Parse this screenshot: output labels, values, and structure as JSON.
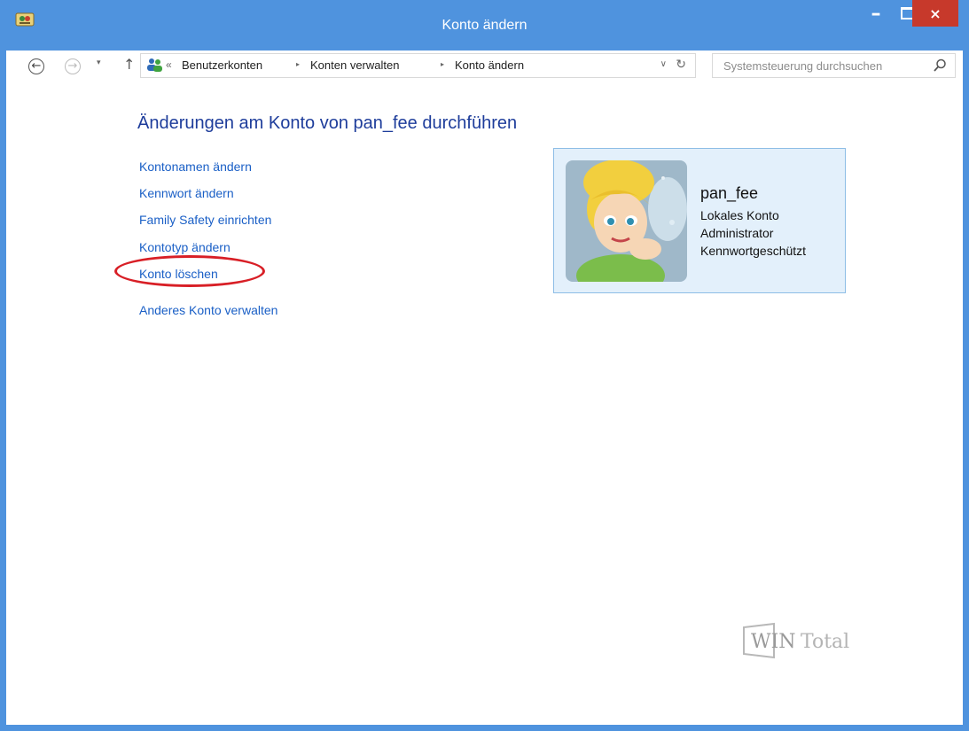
{
  "window": {
    "title": "Konto ändern",
    "icons": {
      "title": "control-panel-icon",
      "minimize": "minimize-icon",
      "maximize": "maximize-icon",
      "close": "close-icon"
    },
    "controls": {
      "minimize": "–",
      "close": "×"
    }
  },
  "navigation": {
    "back": "←",
    "forward": "→",
    "recent": "▾",
    "up": "↑",
    "chevrons": "«",
    "breadcrumbs": [
      "Benutzerkonten",
      "Konten verwalten",
      "Konto ändern"
    ],
    "separator": "▸",
    "dropdown": "∨",
    "refresh": "↻",
    "search_placeholder": "Systemsteuerung durchsuchen"
  },
  "main": {
    "heading": "Änderungen am Konto von pan_fee durchführen",
    "tasks": [
      "Kontonamen ändern",
      "Kennwort ändern",
      "Family Safety einrichten",
      "Kontotyp ändern",
      "Konto löschen"
    ],
    "other_link": "Anderes Konto verwalten",
    "highlighted_task": "Konto löschen",
    "highlight_color": "#d81f26"
  },
  "account": {
    "name": "pan_fee",
    "type": "Lokales Konto",
    "role": "Administrator",
    "protection": "Kennwortgeschützt",
    "avatar_icon": "fairy-avatar-icon"
  },
  "colors": {
    "titlebar": "#4f93de",
    "close_button": "#c7392b",
    "link": "#1a5fc6",
    "heading": "#1e3d9b",
    "card_background": "#e3f0fb",
    "card_border": "#8dbde6"
  },
  "watermark": {
    "text": "WIN Total",
    "icon": "wintotal-logo-icon"
  }
}
